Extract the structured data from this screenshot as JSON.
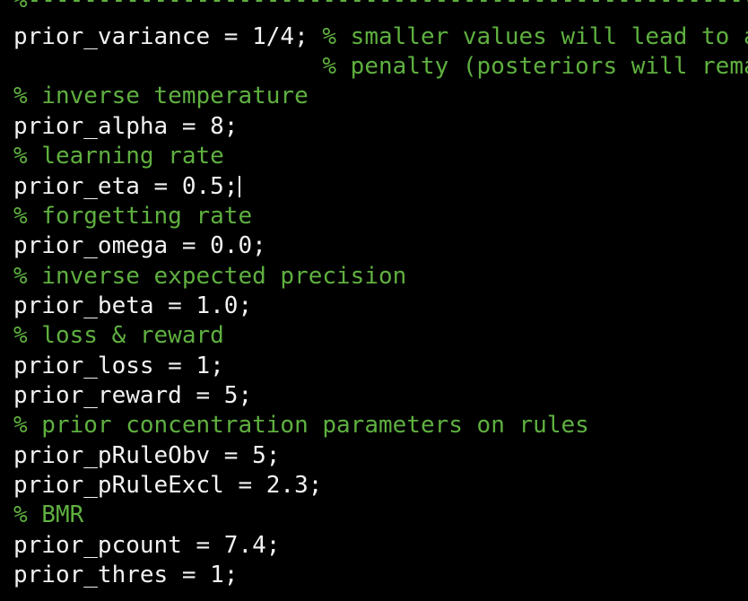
{
  "colors": {
    "background": "#000000",
    "code": "#f2f2f2",
    "comment": "#5fb040"
  },
  "lines": [
    {
      "type": "comment",
      "text": "%------------------------------------------------------------"
    },
    {
      "type": "mixed",
      "code": "prior_variance = 1/4; ",
      "comment": "% smaller values will lead to a"
    },
    {
      "type": "continuation",
      "indent": "                      ",
      "comment": "% penalty (posteriors will rema"
    },
    {
      "type": "comment",
      "text": "% inverse temperature"
    },
    {
      "type": "code",
      "text": "prior_alpha = 8;"
    },
    {
      "type": "comment",
      "text": "% learning rate"
    },
    {
      "type": "code",
      "text": "prior_eta = 0.5;",
      "cursor": true
    },
    {
      "type": "comment",
      "text": "% forgetting rate"
    },
    {
      "type": "code",
      "text": "prior_omega = 0.0;"
    },
    {
      "type": "comment",
      "text": "% inverse expected precision"
    },
    {
      "type": "code",
      "text": "prior_beta = 1.0;"
    },
    {
      "type": "comment",
      "text": "% loss & reward"
    },
    {
      "type": "code",
      "text": "prior_loss = 1;"
    },
    {
      "type": "code",
      "text": "prior_reward = 5;"
    },
    {
      "type": "comment",
      "text": "% prior concentration parameters on rules"
    },
    {
      "type": "code",
      "text": "prior_pRuleObv = 5;"
    },
    {
      "type": "code",
      "text": "prior_pRuleExcl = 2.3;"
    },
    {
      "type": "comment",
      "text": "% BMR"
    },
    {
      "type": "code",
      "text": "prior_pcount = 7.4;"
    },
    {
      "type": "code",
      "text": "prior_thres = 1;"
    }
  ]
}
